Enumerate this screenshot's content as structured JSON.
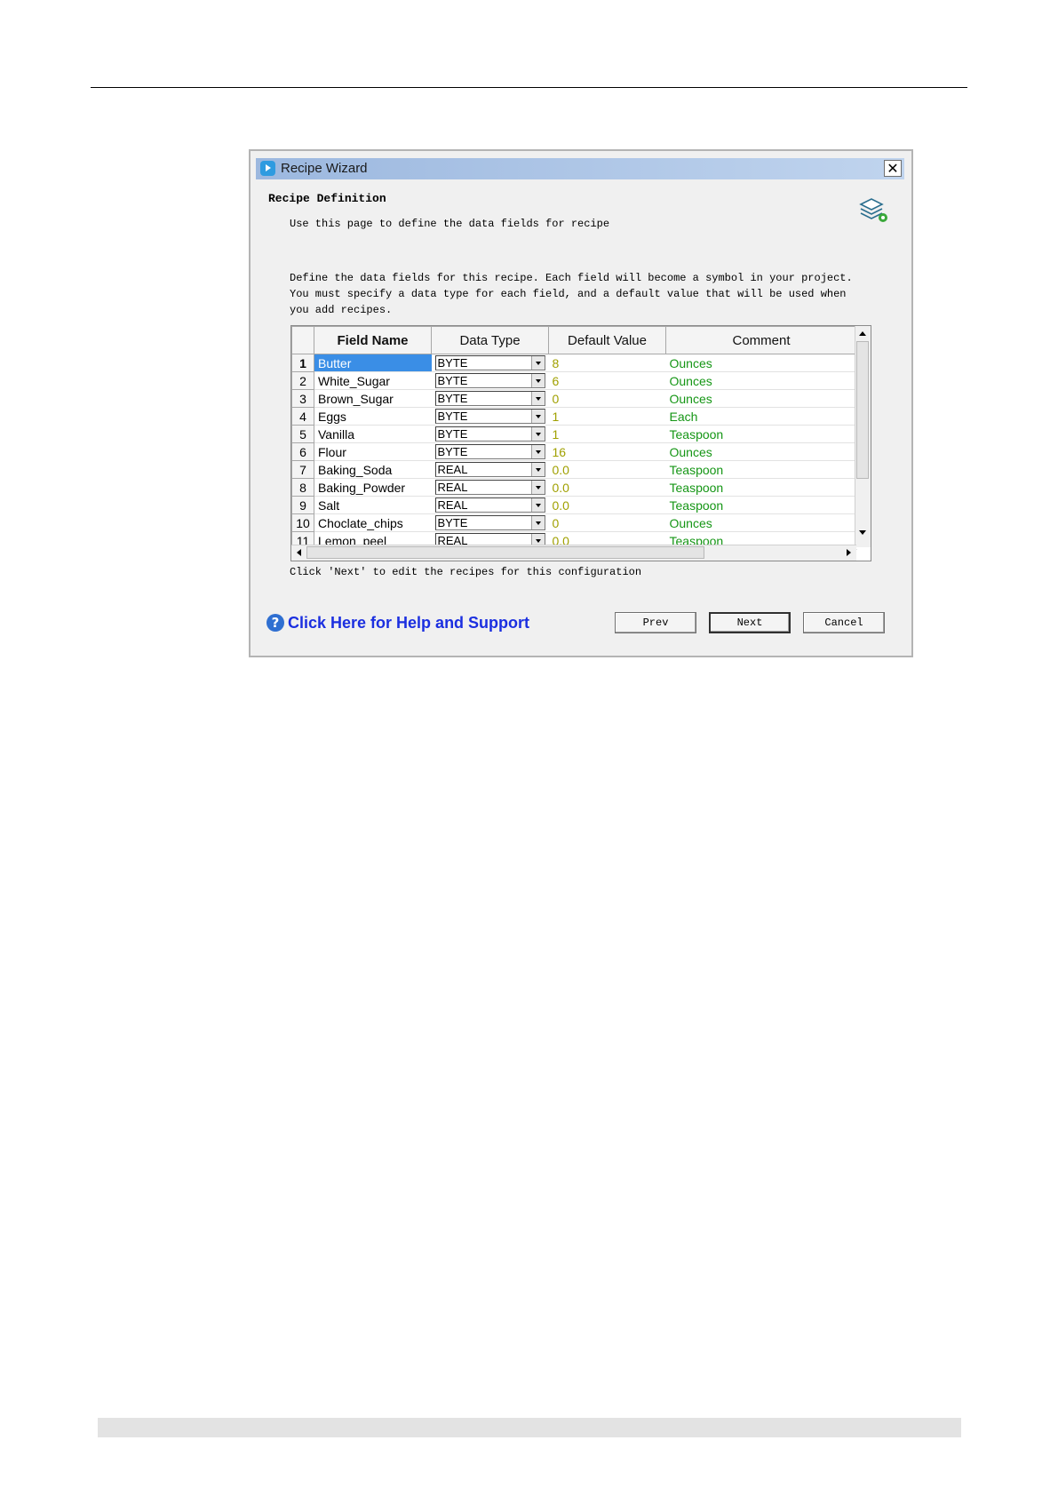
{
  "window": {
    "title": "Recipe Wizard",
    "close_glyph": "✕"
  },
  "page": {
    "section_title": "Recipe Definition",
    "section_subtitle": "Use this page to define the data fields for recipe",
    "description": "Define the data fields for this recipe. Each field will become a symbol in your project.\nYou must specify a data type for each field, and a default value that will be used when\nyou add recipes.",
    "footer_text": "Click 'Next' to edit the recipes for this configuration"
  },
  "grid": {
    "columns": [
      "Field Name",
      "Data Type",
      "Default Value",
      "Comment"
    ],
    "rows": [
      {
        "num": "1",
        "name": "Butter",
        "type": "BYTE",
        "default": "8",
        "comment": "Ounces"
      },
      {
        "num": "2",
        "name": "White_Sugar",
        "type": "BYTE",
        "default": "6",
        "comment": "Ounces"
      },
      {
        "num": "3",
        "name": "Brown_Sugar",
        "type": "BYTE",
        "default": "0",
        "comment": "Ounces"
      },
      {
        "num": "4",
        "name": "Eggs",
        "type": "BYTE",
        "default": "1",
        "comment": "Each"
      },
      {
        "num": "5",
        "name": "Vanilla",
        "type": "BYTE",
        "default": "1",
        "comment": "Teaspoon"
      },
      {
        "num": "6",
        "name": "Flour",
        "type": "BYTE",
        "default": "16",
        "comment": "Ounces"
      },
      {
        "num": "7",
        "name": "Baking_Soda",
        "type": "REAL",
        "default": "0.0",
        "comment": "Teaspoon"
      },
      {
        "num": "8",
        "name": "Baking_Powder",
        "type": "REAL",
        "default": "0.0",
        "comment": "Teaspoon"
      },
      {
        "num": "9",
        "name": "Salt",
        "type": "REAL",
        "default": "0.0",
        "comment": "Teaspoon"
      },
      {
        "num": "10",
        "name": "Choclate_chips",
        "type": "BYTE",
        "default": "0",
        "comment": "Ounces"
      },
      {
        "num": "11",
        "name": "Lemon_peel",
        "type": "REAL",
        "default": "0.0",
        "comment": "Teaspoon"
      }
    ],
    "selected_row": 1
  },
  "help": {
    "label": "Click Here for Help and Support",
    "icon": "question-icon"
  },
  "buttons": {
    "prev": "Prev",
    "next": "Next",
    "cancel": "Cancel"
  },
  "colors": {
    "default_value": "#a0a000",
    "comment": "#159615",
    "selection": "#3a8ee6",
    "help_link": "#1b2fe0"
  }
}
